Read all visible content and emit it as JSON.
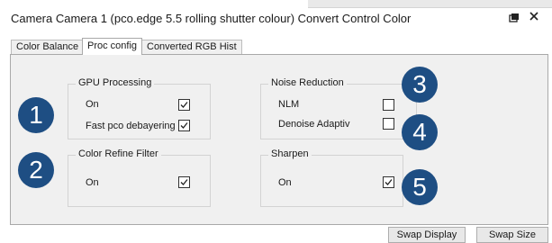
{
  "window": {
    "title": "Camera Camera 1 (pco.edge 5.5 rolling shutter colour) Convert Control Color"
  },
  "tabs": [
    {
      "label": "Color Balance"
    },
    {
      "label": "Proc config"
    },
    {
      "label": "Converted RGB Hist"
    }
  ],
  "groups": {
    "gpu": {
      "title": "GPU Processing",
      "rows": [
        {
          "label": "On",
          "checked": true
        },
        {
          "label": "Fast pco debayering",
          "checked": true
        }
      ]
    },
    "noise": {
      "title": "Noise Reduction",
      "rows": [
        {
          "label": "NLM",
          "checked": false
        },
        {
          "label": "Denoise Adaptiv",
          "checked": false
        }
      ]
    },
    "color_refine": {
      "title": "Color Refine Filter",
      "rows": [
        {
          "label": "On",
          "checked": true
        }
      ]
    },
    "sharpen": {
      "title": "Sharpen",
      "rows": [
        {
          "label": "On",
          "checked": true
        }
      ]
    }
  },
  "badges": [
    "1",
    "2",
    "3",
    "4",
    "5"
  ],
  "buttons": {
    "swap_display": "Swap Display",
    "swap_size": "Swap Size"
  },
  "colors": {
    "badge": "#1e4e83"
  }
}
